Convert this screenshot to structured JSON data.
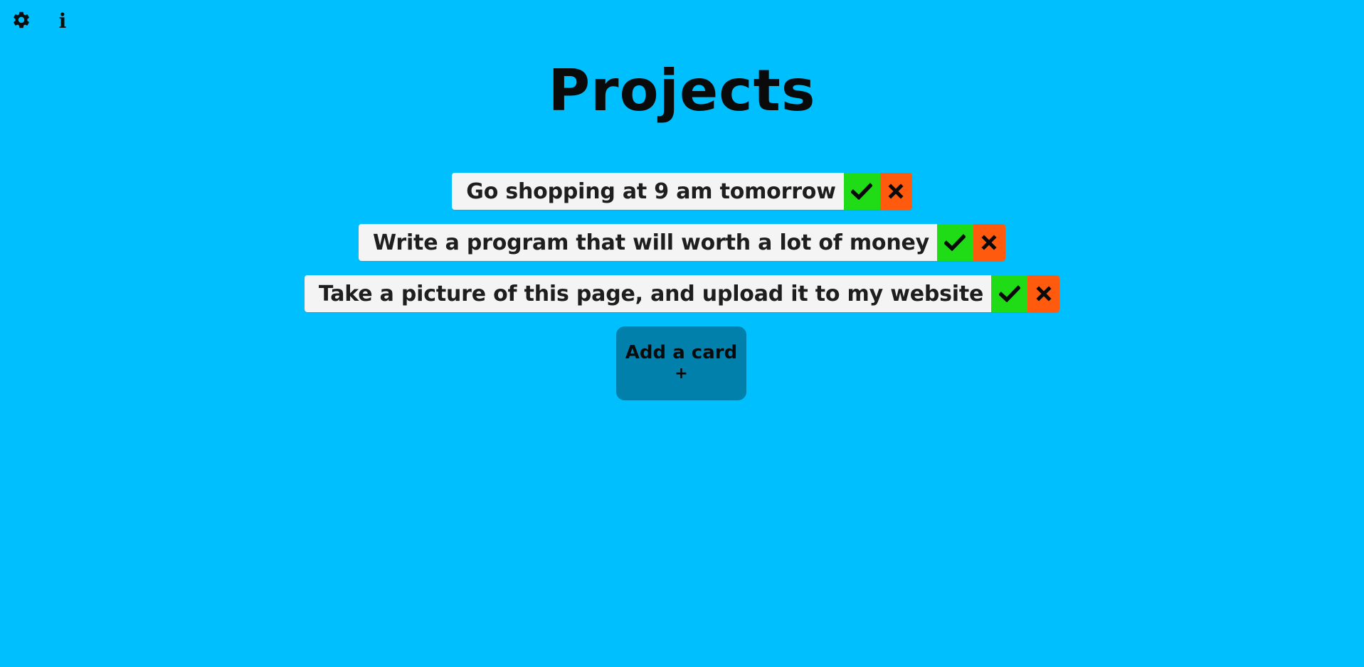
{
  "toolbar": {
    "settings_icon": "gear-icon",
    "info_icon": "info-icon",
    "info_glyph": "i"
  },
  "page": {
    "title": "Projects",
    "background_color": "#00bfff"
  },
  "cards": [
    {
      "text": "Go shopping at 9 am tomorrow"
    },
    {
      "text": "Write a program that will worth a lot of money"
    },
    {
      "text": "Take a picture of this page, and upload it to my website"
    }
  ],
  "card_actions": {
    "done_icon": "check-icon",
    "done_color": "#1fdc16",
    "remove_icon": "close-icon",
    "remove_color": "#ff5a0e"
  },
  "add_card": {
    "label": "Add a card",
    "plus": "+",
    "color": "#0080ab"
  }
}
